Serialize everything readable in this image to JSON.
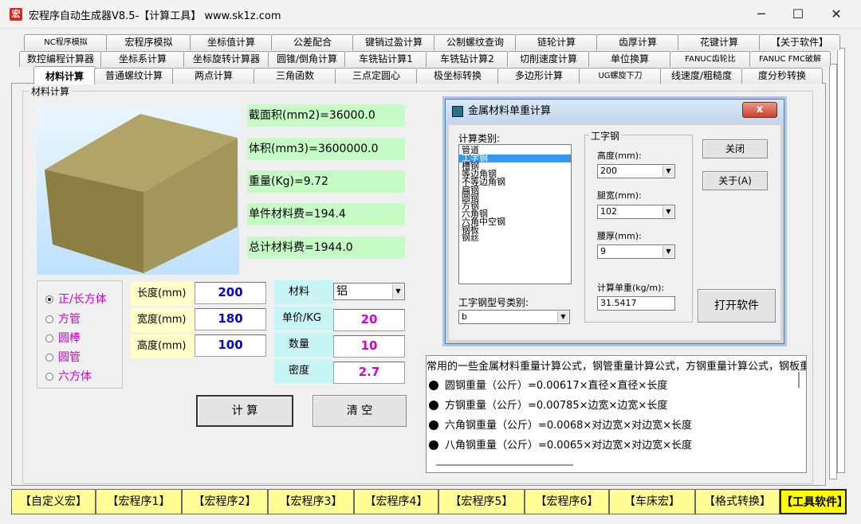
{
  "window": {
    "icon_text": "宏",
    "title": "宏程序自动生成器V8.5-【计算工具】    www.sk1z.com",
    "minimize": "─",
    "maximize": "☐",
    "close": "✕"
  },
  "tabs_row1": [
    "NC程序模拟",
    "宏程序模拟",
    "坐标值计算",
    "公差配合",
    "键销过盈计算",
    "公制螺纹查询",
    "链轮计算",
    "齿厚计算",
    "花键计算",
    "【关于软件】"
  ],
  "tabs_row2": [
    "数控编程计算器",
    "坐标系计算",
    "坐标旋转计算器",
    "圆锥/倒角计算",
    "车铣钻计算1",
    "车铣钻计算2",
    "切削速度计算",
    "单位换算",
    "FANUC齿轮比",
    "FANUC FMC破解"
  ],
  "tabs_row3": [
    "材料计算",
    "普通螺纹计算",
    "两点计算",
    "三角函数",
    "三点定圆心",
    "极坐标转换",
    "多边形计算",
    "UG螺旋下刀",
    "线速度/粗糙度",
    "度分秒转换"
  ],
  "material": {
    "group_title": "材料计算",
    "results": [
      "截面积(mm2)=36000.0",
      "体积(mm3)=3600000.0",
      "重量(Kg)=9.72",
      "单件材料费=194.4",
      "总计材料费=1944.0"
    ],
    "shapes": [
      "正/长方体",
      "方管",
      "圆棒",
      "圆管",
      "六方体"
    ],
    "selected_shape": "正/长方体",
    "dims": [
      {
        "label": "长度(mm)",
        "value": "200"
      },
      {
        "label": "宽度(mm)",
        "value": "180"
      },
      {
        "label": "高度(mm)",
        "value": "100"
      }
    ],
    "material_label": "材料",
    "material_value": "铝",
    "props": [
      {
        "label": "单价/KG",
        "value": "20"
      },
      {
        "label": "数量",
        "value": "10"
      },
      {
        "label": "密度",
        "value": "2.7"
      }
    ],
    "calc_button": "计 算",
    "clear_button": "清 空"
  },
  "dialog": {
    "title": "金属材料单重计算",
    "close": "x",
    "category_label": "计算类别:",
    "categories": [
      "管道",
      "工字钢",
      "槽钢",
      "等边角钢",
      "不等边角钢",
      "扁钢",
      "圆钢",
      "方钢",
      "六角钢",
      "六角中空钢",
      "钢板",
      "钢丝"
    ],
    "selected_category": "工字钢",
    "type_label": "工字钢型号类别:",
    "type_value": "b",
    "section_title": "工字钢",
    "height_label": "高度(mm):",
    "height_value": "200",
    "leg_label": "腿宽(mm):",
    "leg_value": "102",
    "waist_label": "腰厚(mm):",
    "waist_value": "9",
    "unit_weight_label": "计算单重(kg/m):",
    "unit_weight_value": "31.5417",
    "close_button": "关闭",
    "about_button": "关于(A)",
    "open_button": "打开软件"
  },
  "formulas": {
    "header": "常用的一些金属材料重量计算公式，钢管重量计算公式，方钢重量计算公式，钢板重",
    "lines": [
      "圆钢重量（公斤）=0.00617×直径×直径×长度",
      "方钢重量（公斤）=0.00785×边宽×边宽×长度",
      "六角钢重量（公斤）=0.0068×对边宽×对边宽×长度",
      "八角钢重量（公斤）=0.0065×对边宽×对边宽×长度"
    ]
  },
  "bottom_tabs": [
    "【自定义宏】",
    "【宏程序1】",
    "【宏程序2】",
    "【宏程序3】",
    "【宏程序4】",
    "【宏程序5】",
    "【宏程序6】",
    "【车床宏】",
    "【格式转换】",
    "【工具软件】"
  ],
  "active_bottom_tab": "【工具软件】"
}
